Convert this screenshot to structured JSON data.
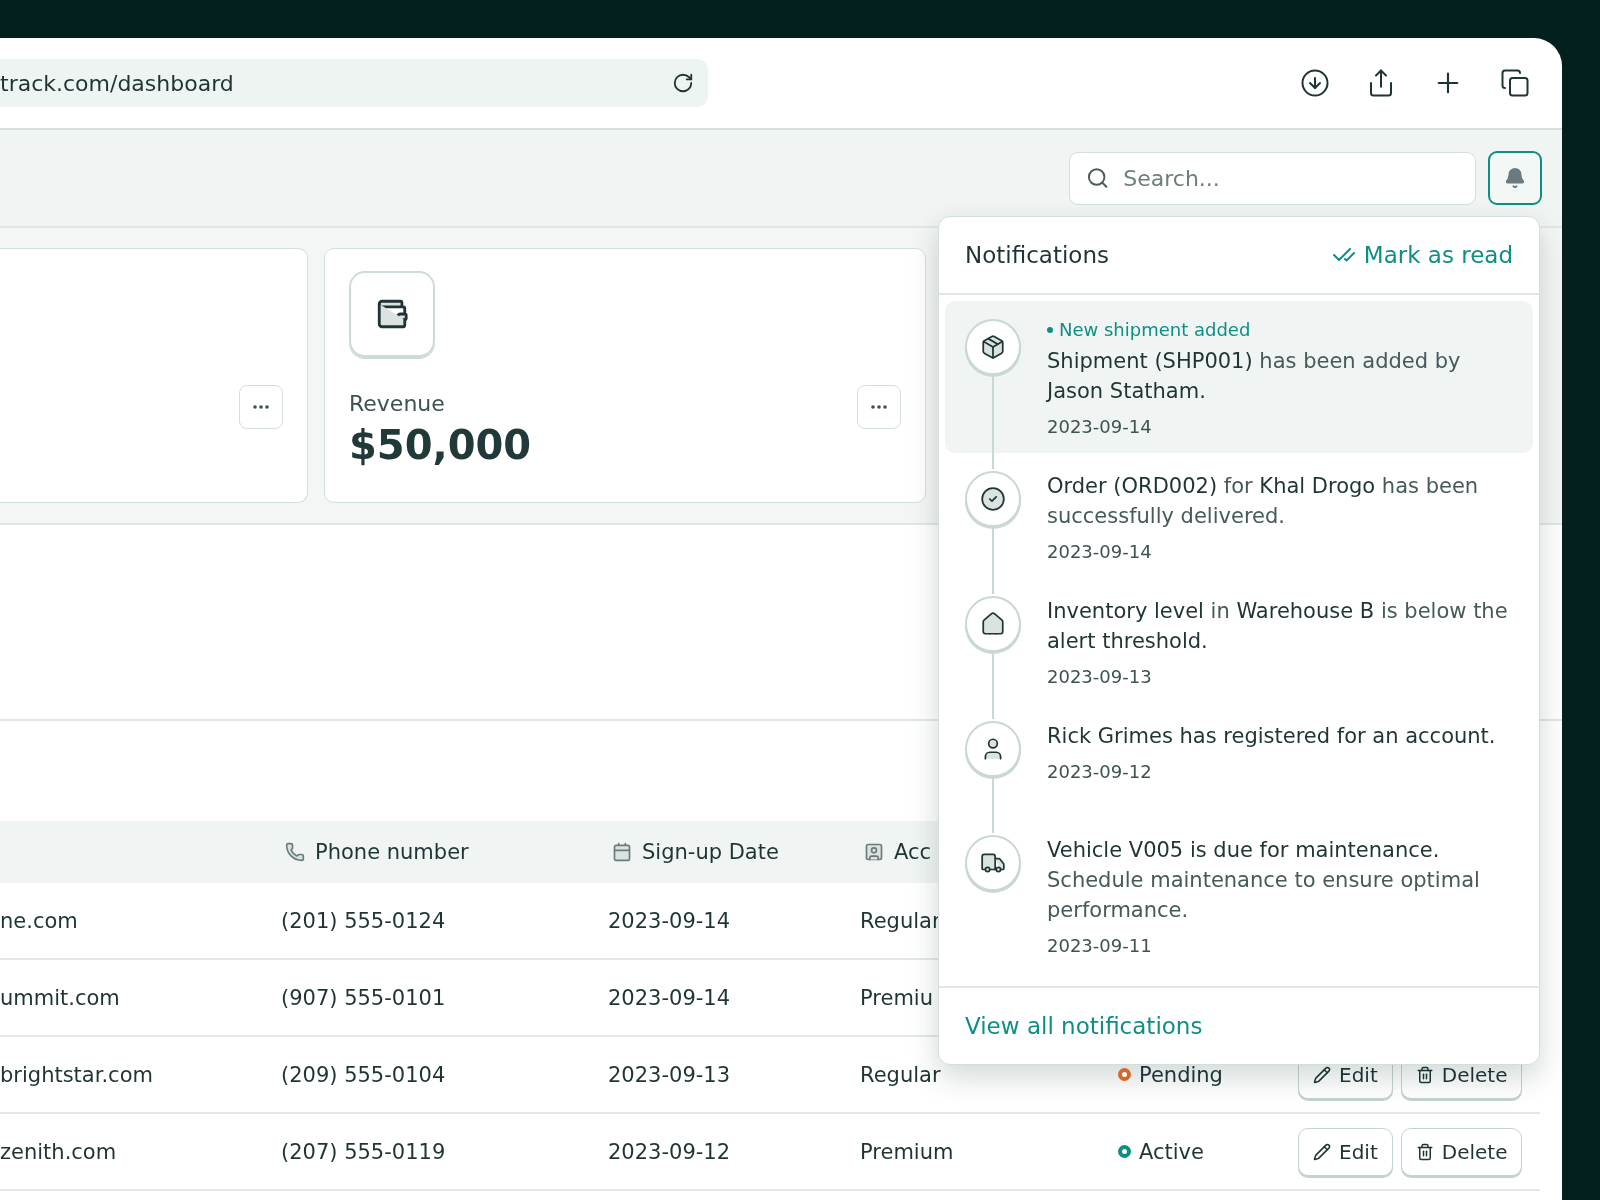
{
  "browser": {
    "address": "track.com/dashboard"
  },
  "header": {
    "search": {
      "placeholder": "Search..."
    },
    "bell": {
      "active": true
    }
  },
  "cards": [
    {
      "kind": "blank"
    },
    {
      "kind": "stat",
      "label": "Revenue",
      "value": "$50,000"
    }
  ],
  "table": {
    "columns": [
      "Phone number",
      "Sign-up Date",
      "Acc"
    ],
    "rows": [
      {
        "email": "ne.com",
        "phone": "(201) 555-0124",
        "date": "2023-09-14",
        "account": "Regular"
      },
      {
        "email": "ummit.com",
        "phone": "(907) 555-0101",
        "date": "2023-09-14",
        "account": "Premiu"
      },
      {
        "email": "brightstar.com",
        "phone": "(209) 555-0104",
        "date": "2023-09-13",
        "account": "Regular",
        "status": {
          "label": "Pending",
          "color": "#d2692f"
        },
        "actions": [
          "Edit",
          "Delete"
        ]
      },
      {
        "email": "zenith.com",
        "phone": "(207) 555-0119",
        "date": "2023-09-12",
        "account": "Premium",
        "status": {
          "label": "Active",
          "color": "#0f8f84"
        },
        "actions": [
          "Edit",
          "Delete"
        ]
      }
    ]
  },
  "notifications": {
    "title": "Notifications",
    "mark_read": "Mark as read",
    "items": [
      {
        "kind": "shipment",
        "unread": true,
        "tag": "New shipment added",
        "text": "**Shipment (SHP001)** has been added by **Jason Statham.**",
        "date": "2023-09-14"
      },
      {
        "kind": "delivered",
        "unread": false,
        "text": "**Order (ORD002)** for **Khal Drogo** has been successfully delivered.",
        "date": "2023-09-14"
      },
      {
        "kind": "inventory",
        "unread": false,
        "text": "**Inventory level** in **Warehouse B** is below the **alert threshold.**",
        "date": "2023-09-13"
      },
      {
        "kind": "account",
        "unread": false,
        "text": "**Rick Grimes has registered for an account.**",
        "date": "2023-09-12"
      },
      {
        "kind": "vehicle",
        "unread": false,
        "text": "**Vehicle V005 is due for maintenance.** Schedule maintenance to ensure optimal performance.",
        "date": "2023-09-11"
      }
    ],
    "footer": "View all notifications"
  }
}
